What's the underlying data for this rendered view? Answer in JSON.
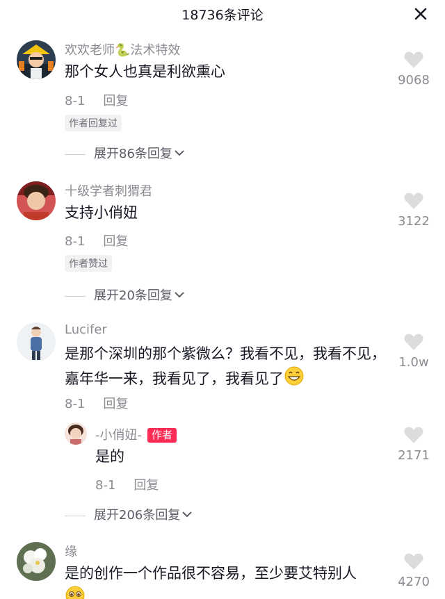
{
  "header": {
    "title": "18736条评论"
  },
  "comments": [
    {
      "username": "欢欢老师🐍法术特效",
      "text": "那个女人也真是利欲熏心",
      "date": "8-1",
      "reply_label": "回复",
      "tag": "作者回复过",
      "likes": "9068",
      "expand": "展开86条回复"
    },
    {
      "username": "十级学者刺猬君",
      "text": "支持小俏妞",
      "date": "8-1",
      "reply_label": "回复",
      "tag": "作者赞过",
      "likes": "3122",
      "expand": "展开20条回复"
    },
    {
      "username": "Lucifer",
      "text": "是那个深圳的那个紫微么？我看不见，我看不见，嘉年华一来，我看见了，我看见了",
      "date": "8-1",
      "reply_label": "回复",
      "likes": "1.0w",
      "expand": "展开206条回复",
      "reply": {
        "username": "-小俏妞-",
        "badge": "作者",
        "text": "是的",
        "date": "8-1",
        "reply_label": "回复",
        "likes": "2171"
      }
    },
    {
      "username": "缘",
      "text": "是的创作一个作品很不容易，至少要艾特别人",
      "likes": "4270"
    }
  ],
  "colors": {
    "text": "#161823",
    "muted": "#8a8b91",
    "accent": "#fe2c55",
    "tag_bg": "#f2f2f3"
  }
}
